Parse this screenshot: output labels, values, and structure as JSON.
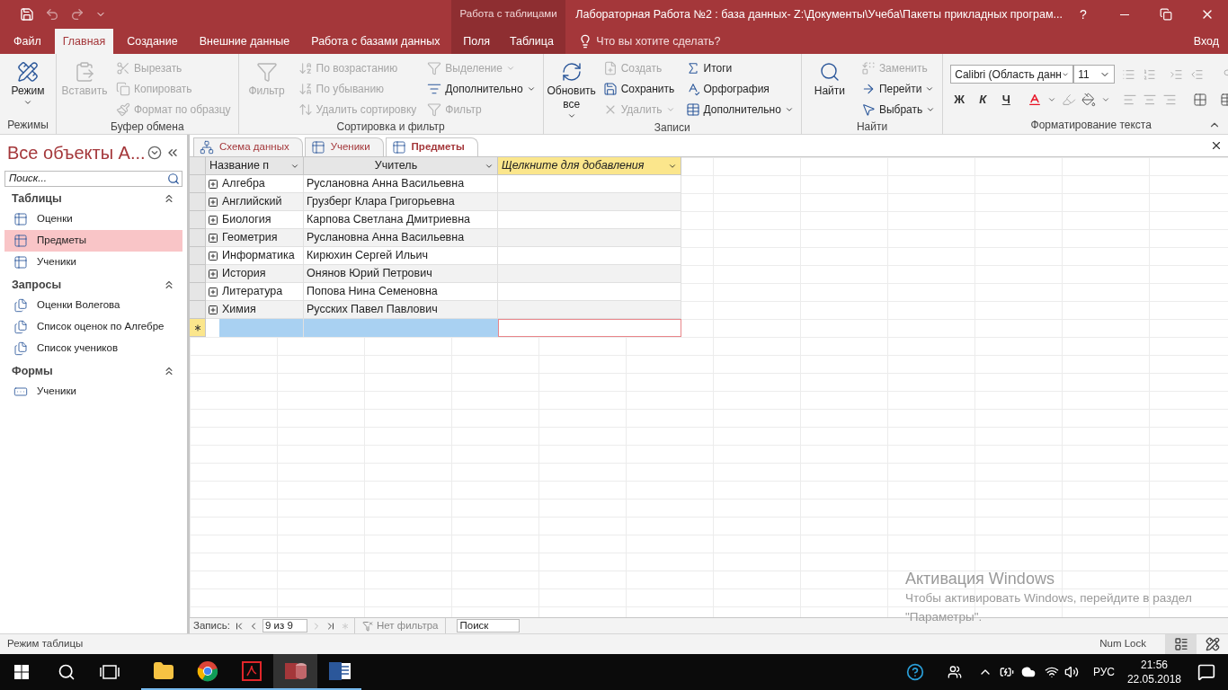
{
  "title_bar": {
    "title": "Лабораторная Работа №2 : база данных- Z:\\Документы\\Учеба\\Пакеты прикладных програм...",
    "help": "?"
  },
  "menu_tabs": [
    {
      "label": "Файл",
      "selected": false
    },
    {
      "label": "Главная",
      "selected": true
    },
    {
      "label": "Создание",
      "selected": false
    },
    {
      "label": "Внешние данные",
      "selected": false
    },
    {
      "label": "Работа с базами данных",
      "selected": false
    }
  ],
  "context_group": {
    "label": "Работа с таблицами",
    "tabs": [
      {
        "label": "Поля",
        "selected": false
      },
      {
        "label": "Таблица",
        "selected": false
      }
    ]
  },
  "tell_me": {
    "placeholder": "Что вы хотите сделать?"
  },
  "sign_in": "Вход",
  "ribbon": {
    "groups": [
      {
        "label": "Режимы",
        "commands": [
          {
            "label": "Режим",
            "kind": "large",
            "disabled": false
          }
        ]
      },
      {
        "label": "Буфер обмена",
        "commands": [
          {
            "label": "Вставить",
            "kind": "large",
            "disabled": true
          },
          {
            "label": "Вырезать",
            "kind": "small",
            "disabled": true
          },
          {
            "label": "Копировать",
            "kind": "small",
            "disabled": true
          },
          {
            "label": "Формат по образцу",
            "kind": "small",
            "disabled": true
          }
        ]
      },
      {
        "label": "Сортировка и фильтр",
        "commands": [
          {
            "label": "Фильтр",
            "kind": "large",
            "disabled": true
          },
          {
            "label": "По возрастанию",
            "kind": "small",
            "disabled": true
          },
          {
            "label": "По убыванию",
            "kind": "small",
            "disabled": true
          },
          {
            "label": "Удалить сортировку",
            "kind": "small",
            "disabled": true
          },
          {
            "label": "Выделение",
            "kind": "small",
            "disabled": true
          },
          {
            "label": "Дополнительно",
            "kind": "small",
            "disabled": false
          },
          {
            "label": "Фильтр",
            "kind": "small",
            "disabled": true
          }
        ]
      },
      {
        "label": "Записи",
        "commands": [
          {
            "label": "Обновить все",
            "kind": "large",
            "disabled": false
          },
          {
            "label": "Создать",
            "kind": "small",
            "disabled": true
          },
          {
            "label": "Сохранить",
            "kind": "small",
            "disabled": false
          },
          {
            "label": "Удалить",
            "kind": "small",
            "disabled": true
          },
          {
            "label": "Итоги",
            "kind": "small",
            "disabled": false
          },
          {
            "label": "Орфография",
            "kind": "small",
            "disabled": false
          },
          {
            "label": "Дополнительно",
            "kind": "small",
            "disabled": false
          }
        ]
      },
      {
        "label": "Найти",
        "commands": [
          {
            "label": "Найти",
            "kind": "large",
            "disabled": false
          },
          {
            "label": "Заменить",
            "kind": "small",
            "disabled": true
          },
          {
            "label": "Перейти",
            "kind": "small",
            "disabled": false
          },
          {
            "label": "Выбрать",
            "kind": "small",
            "disabled": false
          }
        ]
      }
    ],
    "text_format": {
      "label": "Форматирование текста",
      "font": "Calibri (Область данн",
      "size": "11",
      "style_buttons": [
        "Ж",
        "К",
        "Ч"
      ]
    }
  },
  "nav_pane": {
    "title": "Все объекты А...",
    "search": {
      "placeholder": "Поиск..."
    },
    "sections": [
      {
        "label": "Таблицы",
        "kind": "table",
        "items": [
          {
            "label": "Оценки",
            "selected": false
          },
          {
            "label": "Предметы",
            "selected": true
          },
          {
            "label": "Ученики",
            "selected": false
          }
        ]
      },
      {
        "label": "Запросы",
        "kind": "query",
        "items": [
          {
            "label": "Оценки Волегова",
            "selected": false
          },
          {
            "label": "Список оценок по Алгебре",
            "selected": false
          },
          {
            "label": "Список учеников",
            "selected": false
          }
        ]
      },
      {
        "label": "Формы",
        "kind": "form",
        "items": [
          {
            "label": "Ученики",
            "selected": false
          }
        ]
      }
    ]
  },
  "doc_tabs": [
    {
      "label": "Схема данных",
      "kind": "diagram",
      "selected": false
    },
    {
      "label": "Ученики",
      "kind": "table",
      "selected": false
    },
    {
      "label": "Предметы",
      "kind": "table",
      "selected": true
    }
  ],
  "table": {
    "columns": [
      {
        "label": "Название п",
        "kind": "field"
      },
      {
        "label": "Учитель",
        "kind": "field"
      },
      {
        "label": "Щелкните для добавления",
        "kind": "add"
      }
    ],
    "rows": [
      [
        "Алгебра",
        "Руслановна Анна Васильевна"
      ],
      [
        "Английский",
        "Грузберг Клара Григорьевна"
      ],
      [
        "Биология",
        "Карпова Светлана Дмитриевна"
      ],
      [
        "Геометрия",
        "Руслановна Анна Васильевна"
      ],
      [
        "Информатика",
        "Кирюхин Сергей Ильич"
      ],
      [
        "История",
        "Онянов Юрий Петрович"
      ],
      [
        "Литература",
        "Попова Нина Семеновна"
      ],
      [
        "Химия",
        "Русских Павел Павлович"
      ]
    ],
    "new_row": {
      "selected": true
    }
  },
  "record_nav": {
    "label": "Запись:",
    "position": "9 из 9",
    "filter": "Нет фильтра",
    "search": {
      "placeholder": "Поиск"
    }
  },
  "status_bar": {
    "mode": "Режим таблицы",
    "num_lock": "Num Lock"
  },
  "activation": {
    "title": "Активация Windows",
    "text": "Чтобы активировать Windows, перейдите в раздел \"Параметры\"."
  },
  "taskbar": {
    "apps": [
      {
        "active": false
      },
      {
        "active": false
      },
      {
        "active": false
      },
      {
        "active": true
      },
      {
        "active": false
      }
    ],
    "language": "РУС",
    "time": "21:56",
    "date": "22.05.2018"
  }
}
